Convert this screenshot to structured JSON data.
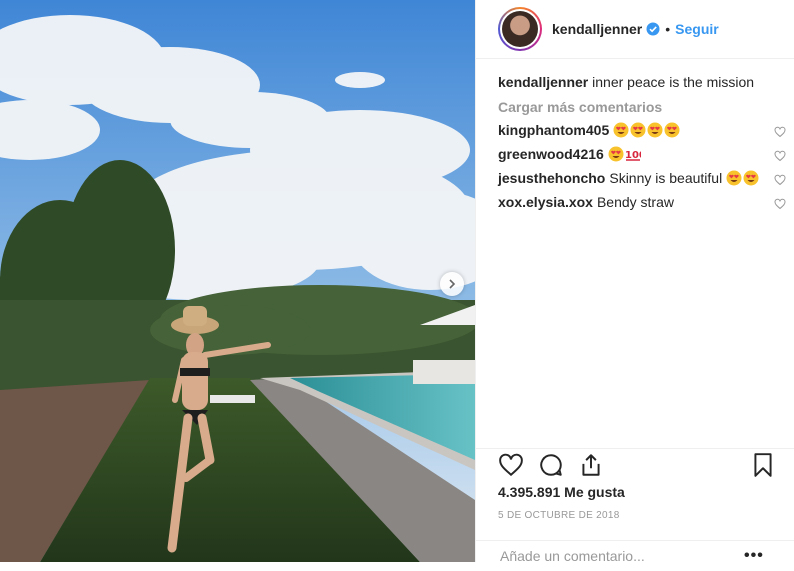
{
  "header": {
    "username": "kendalljenner",
    "separator": "•",
    "follow_label": "Seguir"
  },
  "caption": {
    "username": "kendalljenner",
    "text": "inner peace is the mission"
  },
  "load_more_label": "Cargar más comentarios",
  "comments": [
    {
      "username": "kingphantom405",
      "text": "",
      "emojis": [
        "heart-eyes",
        "heart-eyes",
        "heart-eyes",
        "heart-eyes"
      ]
    },
    {
      "username": "greenwood4216",
      "text": "",
      "emojis": [
        "heart-eyes",
        "hundred"
      ]
    },
    {
      "username": "jesusthehoncho",
      "text": "Skinny is beautiful",
      "emojis": [
        "heart-eyes",
        "heart-eyes"
      ]
    },
    {
      "username": "xox.elysia.xox",
      "text": "Bendy straw",
      "emojis": []
    }
  ],
  "likes": "4.395.891 Me gusta",
  "date": "5 DE OCTUBRE DE 2018",
  "add_comment": {
    "placeholder": "Añade un comentario...",
    "more": "•••"
  },
  "colors": {
    "link": "#3897f0",
    "muted": "#999999",
    "text": "#262626",
    "verified": "#3897f0"
  },
  "icons": [
    "verified-badge-icon",
    "heart-icon",
    "comment-icon",
    "share-icon",
    "bookmark-icon",
    "chevron-right-icon",
    "more-options-icon"
  ]
}
